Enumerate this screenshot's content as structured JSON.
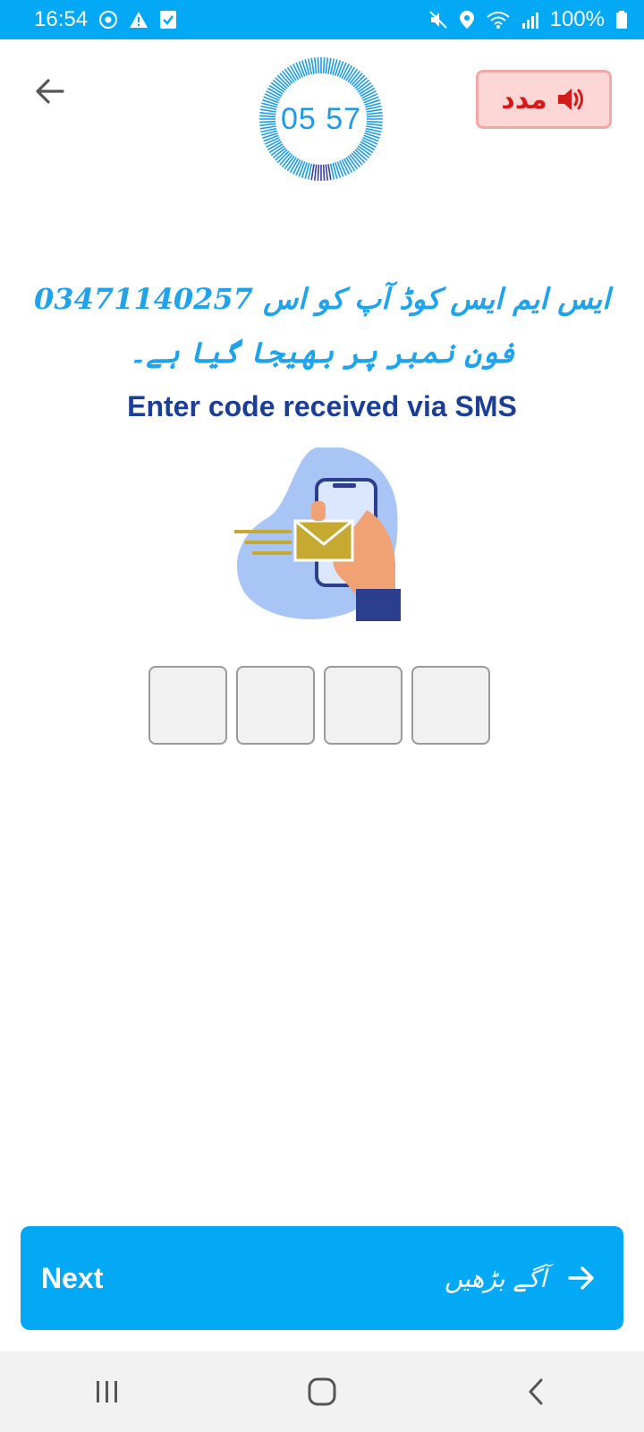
{
  "status_bar": {
    "time": "16:54",
    "battery": "100%",
    "left_icons": [
      "eye-circle-icon",
      "warning-icon",
      "check-box-icon"
    ],
    "right_icons": [
      "mute-icon",
      "location-icon",
      "wifi-icon",
      "signal-icon",
      "battery-icon"
    ]
  },
  "header": {
    "timer": "05 57",
    "help_label": "مدد",
    "help_icon": "speaker-icon"
  },
  "message": {
    "urdu": "ایس ایم ایس کوڈ آپ کو اس 03471140257 فون نمبر پر بھیجا گیا ہے۔",
    "english": "Enter code received via SMS"
  },
  "code_inputs": [
    "",
    "",
    "",
    ""
  ],
  "next_button": {
    "label_en": "Next",
    "label_ur": "آگے بڑھیں"
  },
  "colors": {
    "primary": "#03a9f4",
    "heading": "#1c3f95",
    "urdu_text": "#1fa3ea",
    "help_bg": "#fdd6d6",
    "help_text": "#d41a1a"
  }
}
